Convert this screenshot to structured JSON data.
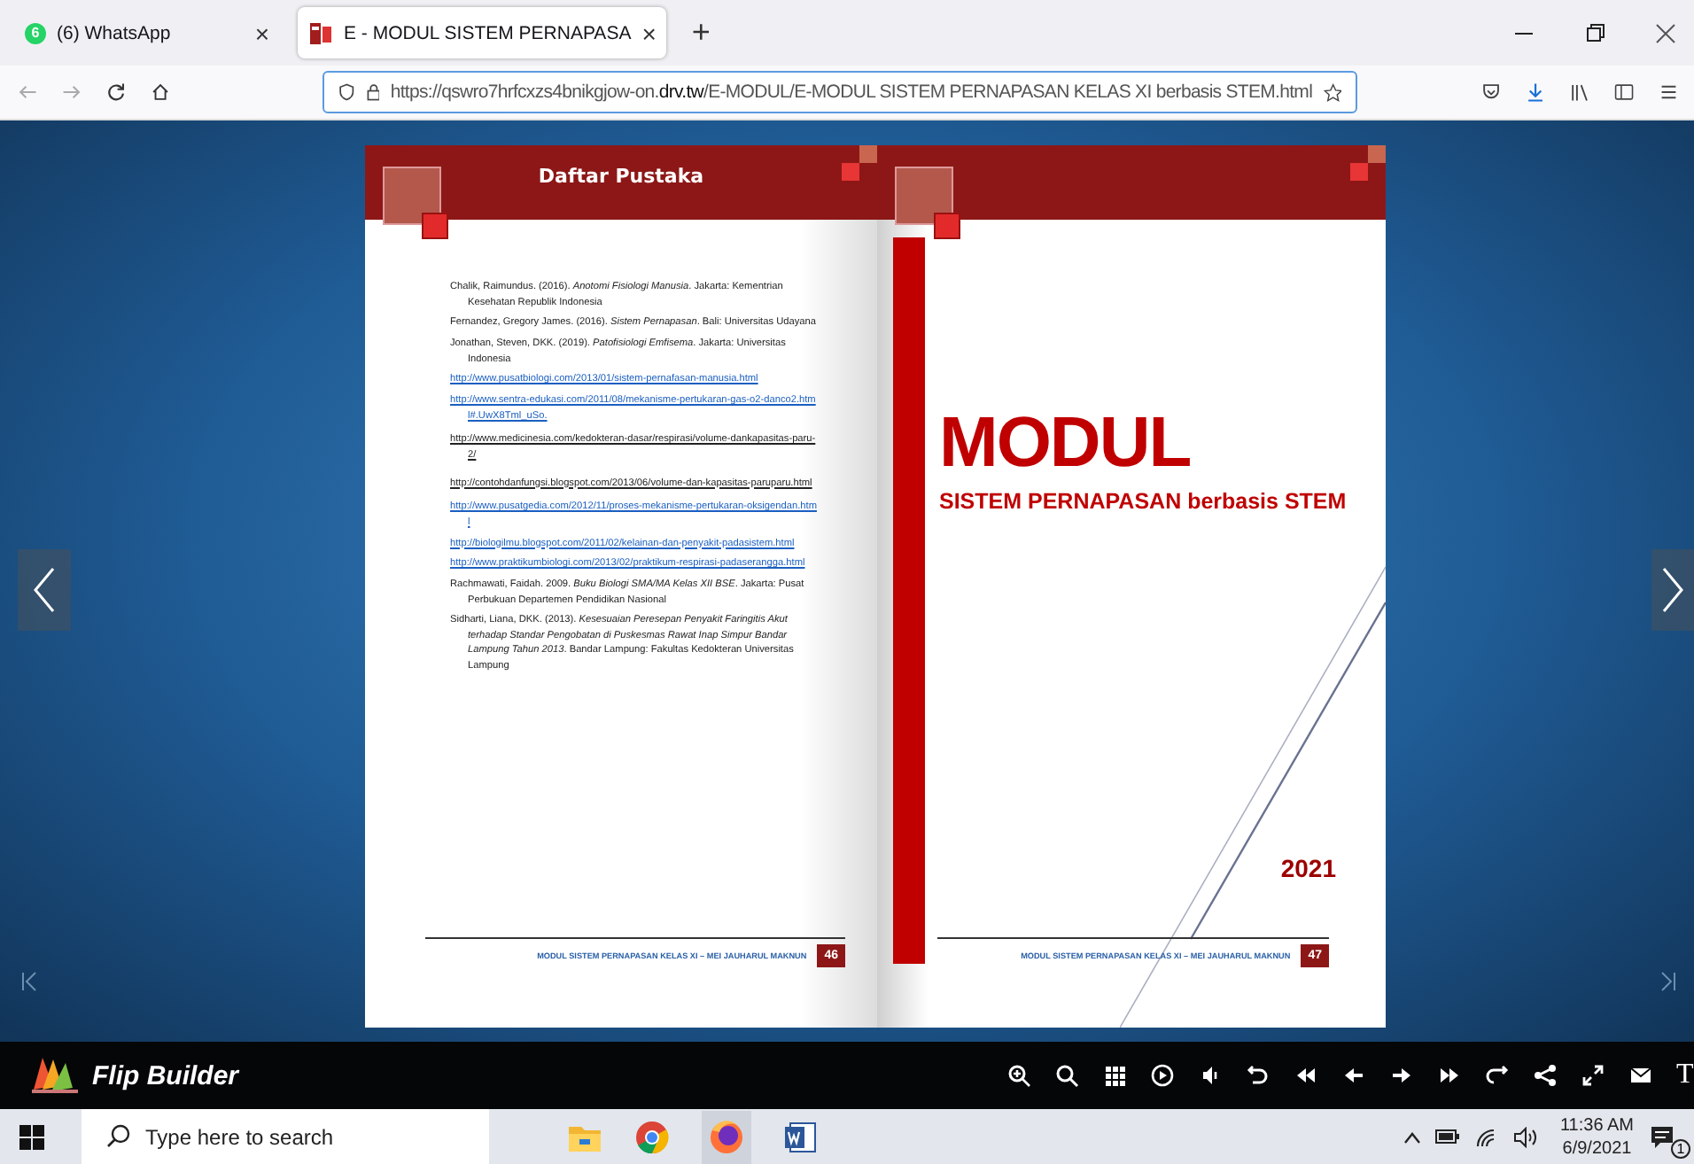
{
  "tabs": [
    {
      "title": "(6) WhatsApp",
      "badge": "6",
      "close": "×",
      "selected": false
    },
    {
      "title": "E - MODUL SISTEM PERNAPASA",
      "close": "×",
      "selected": true
    }
  ],
  "new_tab": "+",
  "address": {
    "prefix": "https://qswro7hrfcxzs4bnikgjow-on.",
    "domain": "drv.tw",
    "path": "/E-MODUL/E-MODUL SISTEM PERNAPASAN KELAS XI berbasis STEM.html"
  },
  "left_page": {
    "heading": "Daftar Pustaka",
    "references": [
      {
        "kind": "text",
        "text": "Chalik, Raimundus. (2016). *Anotomi Fisiologi Manusia*. Jakarta: Kementrian Kesehatan Republik Indonesia"
      },
      {
        "kind": "text",
        "text": "Fernandez, Gregory James. (2016). *Sistem Pernapasan*. Bali: Universitas Udayana"
      },
      {
        "kind": "text",
        "text": "Jonathan, Steven, DKK. (2019). *Patofisiologi Emfisema*. Jakarta: Universitas Indonesia"
      },
      {
        "kind": "link",
        "text": "http://www.pusatbiologi.com/2013/01/sistem-pernafasan-manusia.html"
      },
      {
        "kind": "link",
        "text": "http://www.sentra-edukasi.com/2011/08/mekanisme-pertukaran-gas-o2-danco2.html#.UwX8Tml_uSo."
      },
      {
        "kind": "plainlink",
        "text": "http://www.medicinesia.com/kedokteran-dasar/respirasi/volume-dankapasitas-paru-2/"
      },
      {
        "kind": "plainlink",
        "text": "http://contohdanfungsi.blogspot.com/2013/06/volume-dan-kapasitas-paruparu.html"
      },
      {
        "kind": "link",
        "text": "http://www.pusatgedia.com/2012/11/proses-mekanisme-pertukaran-oksigendan.html"
      },
      {
        "kind": "link",
        "text": "http://biologilmu.blogspot.com/2011/02/kelainan-dan-penyakit-padasistem.html"
      },
      {
        "kind": "link",
        "text": "http://www.praktikumbiologi.com/2013/02/praktikum-respirasi-padaserangga.html"
      },
      {
        "kind": "text",
        "text": "Rachmawati, Faidah. 2009. *Buku Biologi SMA/MA Kelas XII BSE*. Jakarta: Pusat Perbukuan Departemen Pendidikan Nasional"
      },
      {
        "kind": "text",
        "text": "Sidharti, Liana, DKK. (2013). *Kesesuaian Peresepan Penyakit Faringitis Akut terhadap Standar Pengobatan di Puskesmas Rawat Inap Simpur Bandar Lampung Tahun 2013*. Bandar Lampung: Fakultas Kedokteran Universitas Lampung"
      }
    ],
    "footer": "MODUL SISTEM PERNAPASAN KELAS XI – MEI JAUHARUL MAKNUN",
    "page_number": "46"
  },
  "right_page": {
    "title": "MODUL",
    "subtitle": "SISTEM PERNAPASAN berbasis STEM",
    "year": "2021",
    "footer": "MODUL SISTEM PERNAPASAN KELAS XI – MEI JAUHARUL MAKNUN",
    "page_number": "47"
  },
  "viewer_bar": {
    "brand": "Flip Builder",
    "last_button": "T"
  },
  "taskbar": {
    "search_placeholder": "Type here to search",
    "time": "11:36 AM",
    "date": "6/9/2021",
    "notifications": "1"
  }
}
